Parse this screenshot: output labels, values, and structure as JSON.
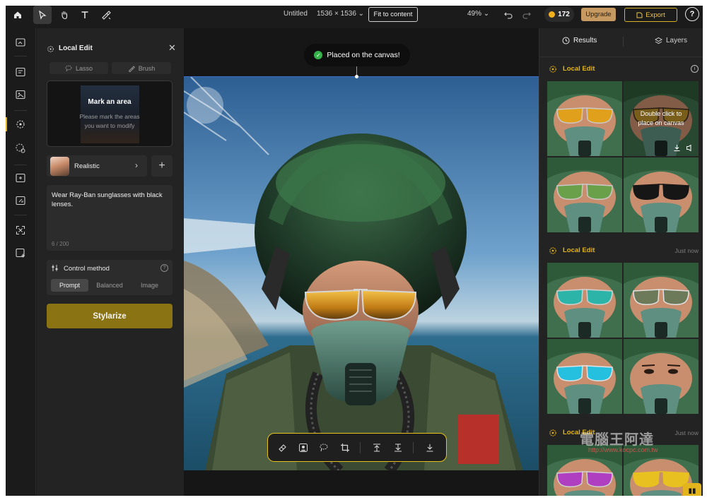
{
  "topbar": {
    "document_title": "Untitled",
    "canvas_size": "1536 × 1536 ⌄",
    "fit_label": "Fit to content",
    "zoom": "49% ⌄",
    "credits": "172",
    "upgrade_label": "Upgrade",
    "export_label": "Export",
    "help_label": "?"
  },
  "left_panel": {
    "title": "Local Edit",
    "tools": {
      "lasso_label": "Lasso",
      "brush_label": "Brush"
    },
    "mark_card": {
      "title": "Mark an area",
      "hint": "Please mark the areas you want to modify"
    },
    "style": {
      "label": "Realistic"
    },
    "prompt": {
      "text": "Wear Ray-Ban sunglasses with black lenses.",
      "count": "6 / 200"
    },
    "control": {
      "title": "Control method",
      "options": [
        "Prompt",
        "Balanced",
        "Image"
      ],
      "selected": "Prompt"
    },
    "stylize_label": "Stylarize"
  },
  "canvas": {
    "toast": "Placed on the canvas!"
  },
  "right_panel": {
    "tabs": [
      {
        "label": "Results",
        "icon": "clock-icon",
        "active": true
      },
      {
        "label": "Layers",
        "icon": "layers-icon",
        "active": false
      }
    ],
    "groups": [
      {
        "title": "Local Edit",
        "meta": "",
        "hover_text": "Double click to place on canvas",
        "thumbs": [
          {
            "lens": "#e0a01c",
            "frame": "#c9c9c9"
          },
          {
            "lens": "#b8902a",
            "frame": "#3a2c1e"
          },
          {
            "lens": "#6aa04a",
            "frame": "#c9c9c9"
          },
          {
            "lens": "#161616",
            "frame": "#161616"
          }
        ]
      },
      {
        "title": "Local Edit",
        "meta": "Just now",
        "thumbs": [
          {
            "lens": "#2cb4a8",
            "frame": "#d0d0d0"
          },
          {
            "lens": "#6c7a5a",
            "frame": "#e2e2e2"
          },
          {
            "lens": "#25c0e0",
            "frame": "#e2e2e2"
          },
          {
            "lens": "none",
            "frame": "none"
          }
        ]
      },
      {
        "title": "Local Edit",
        "meta": "Just now",
        "thumbs": [
          {
            "lens": "#b03ec0",
            "frame": "#d0d0d0"
          },
          {
            "lens": "#e8c020",
            "frame": "#e8c020"
          }
        ]
      }
    ]
  },
  "watermark": {
    "text": "電腦王阿達",
    "url": "http://www.kocpc.com.tw"
  },
  "colors": {
    "accent": "#e3b41c",
    "stylize": "#8a7312",
    "upgrade": "#c79a62",
    "toast_check": "#36b24a",
    "selection": "#3c6fcc"
  }
}
